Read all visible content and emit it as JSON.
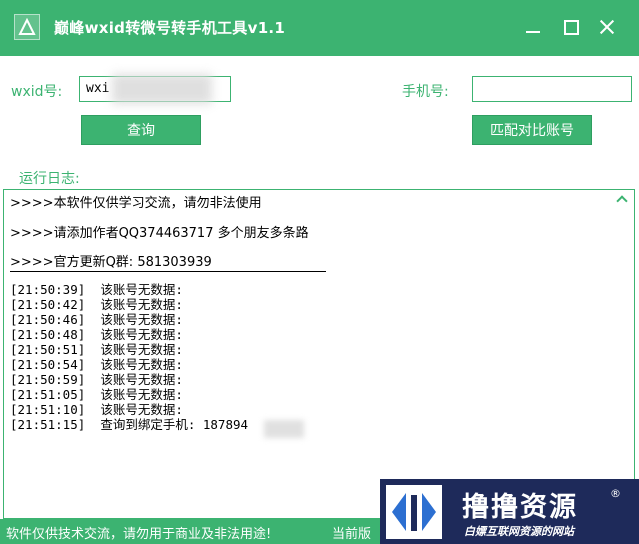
{
  "window": {
    "title": "巅峰wxid转微号转手机工具v1.1"
  },
  "query": {
    "wxid_label": "wxid号:",
    "wxid_value": "wxi",
    "phone_label": "手机号:",
    "phone_value": "",
    "query_button": "查询",
    "match_button": "匹配对比账号"
  },
  "log": {
    "label": "运行日志:",
    "notices": [
      ">>>>本软件仅供学习交流，请勿非法使用",
      ">>>>请添加作者QQ374463717 多个朋友多条路",
      ">>>>官方更新Q群: 581303939"
    ],
    "entries": [
      {
        "time": "[21:50:39]",
        "message": "该账号无数据:"
      },
      {
        "time": "[21:50:42]",
        "message": "该账号无数据:"
      },
      {
        "time": "[21:50:46]",
        "message": "该账号无数据:"
      },
      {
        "time": "[21:50:48]",
        "message": "该账号无数据:"
      },
      {
        "time": "[21:50:51]",
        "message": "该账号无数据:"
      },
      {
        "time": "[21:50:54]",
        "message": "该账号无数据:"
      },
      {
        "time": "[21:50:59]",
        "message": "该账号无数据:"
      },
      {
        "time": "[21:51:05]",
        "message": "该账号无数据:"
      },
      {
        "time": "[21:51:10]",
        "message": "该账号无数据:"
      },
      {
        "time": "[21:51:15]",
        "message": "查询到绑定手机: 187894"
      }
    ]
  },
  "statusbar": {
    "notice": "软件仅供技术交流，请勿用于商业及非法用途!",
    "version": "当前版"
  },
  "watermark": {
    "title": "撸撸资源",
    "registered": "®",
    "subtitle": "白嫖互联网资源的网站"
  },
  "colors": {
    "accent": "#3cb371",
    "watermark_bg": "#1e2a5a"
  }
}
